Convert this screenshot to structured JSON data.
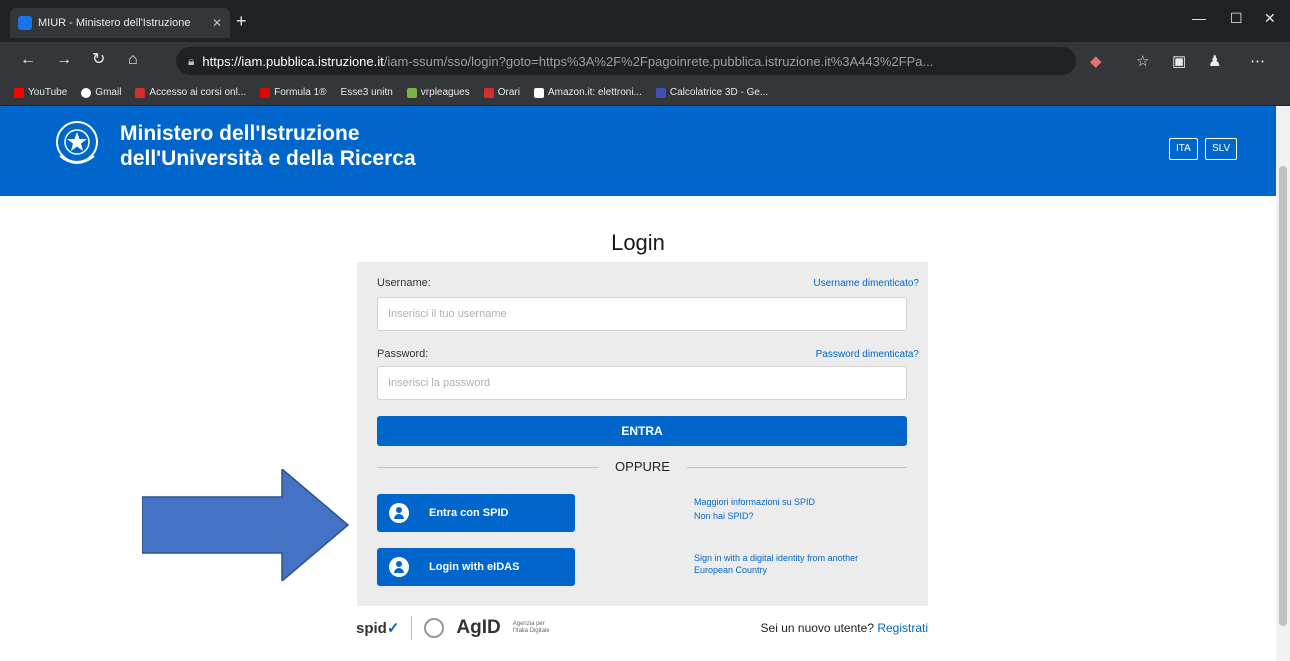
{
  "browser": {
    "tab_title": "MIUR - Ministero dell'Istruzione",
    "new_tab": "+",
    "url_host": "https://iam.pubblica.istruzione.it",
    "url_path": "/iam-ssum/sso/login?goto=https%3A%2F%2Fpagoinrete.pubblica.istruzione.it%3A443%2FPa...",
    "bookmarks": [
      "YouTube",
      "Gmail",
      "Accesso ai corsi onl...",
      "Formula 1®",
      "Esse3 unitn",
      "vrpleagues",
      "Orari",
      "Amazon.it: elettroni...",
      "Calcolatrice 3D - Ge..."
    ]
  },
  "header": {
    "title_line1": "Ministero dell'Istruzione",
    "title_line2": "dell'Università e della Ricerca",
    "lang_ita": "ITA",
    "lang_slv": "SLV"
  },
  "login": {
    "title": "Login",
    "username_label": "Username:",
    "username_forgot": "Username dimenticato?",
    "username_placeholder": "Inserisci il tuo username",
    "password_label": "Password:",
    "password_forgot": "Password dimenticata?",
    "password_placeholder": "Inserisci la password",
    "submit": "ENTRA",
    "or": "OPPURE",
    "spid_button": "Entra con SPID",
    "eidas_button": "Login with eIDAS",
    "spid_info_1": "Maggiori informazioni su SPID",
    "spid_info_2": "Non hai SPID?",
    "eidas_info": "Sign in with a digital identity from another European Country"
  },
  "footer": {
    "spid_logo": "spid",
    "agid_logo": "AgID",
    "agid_sub": "Agenzia per l'Italia Digitale",
    "new_user": "Sei un nuovo utente?",
    "register": "Registrati"
  },
  "colors": {
    "brand_blue": "#0066cc",
    "arrow_blue": "#4472c4"
  }
}
